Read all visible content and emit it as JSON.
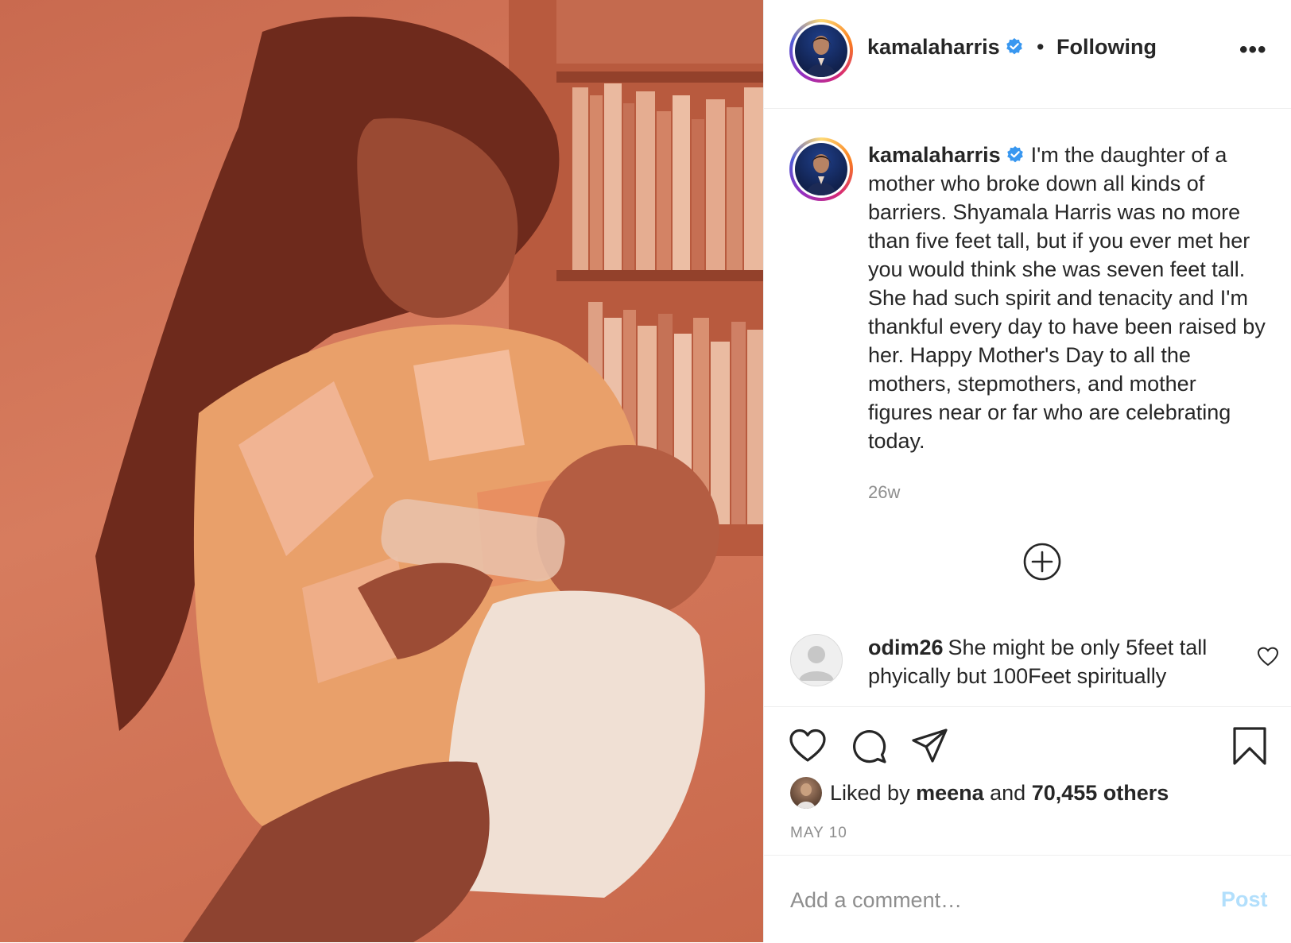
{
  "post": {
    "username": "kamalaharris",
    "verified": true,
    "follow_dot": "•",
    "follow_status": "Following",
    "more_label": "•••",
    "caption": "I'm the daughter of a mother who broke down all kinds of barriers. Shyamala Harris was no more than five feet tall, but if you ever met her you would think she was seven feet tall. She had such spirit and tenacity and I'm thankful every day to have been raised by her. Happy Mother's Day to all the mothers, stepmothers, and mother figures near or far who are celebrating today.",
    "age": "26w"
  },
  "comments": [
    {
      "username": "odim26",
      "text": "She might be only 5feet tall phyically but 100Feet spiritually"
    }
  ],
  "likes": {
    "prefix": "Liked by ",
    "liker": "meena",
    "joiner": " and ",
    "others": "70,455 others"
  },
  "date": "MAY 10",
  "add_comment": {
    "placeholder": "Add a comment…",
    "post_label": "Post"
  },
  "colors": {
    "verified_blue": "#3897f0",
    "post_button_disabled": "#b2dffc",
    "secondary_text": "#8e8e8e"
  },
  "icons": {
    "like": "heart-icon",
    "comment": "comment-bubble-icon",
    "share": "paper-plane-icon",
    "save": "bookmark-icon",
    "load_more": "plus-circle-icon",
    "more": "ellipsis-icon"
  }
}
